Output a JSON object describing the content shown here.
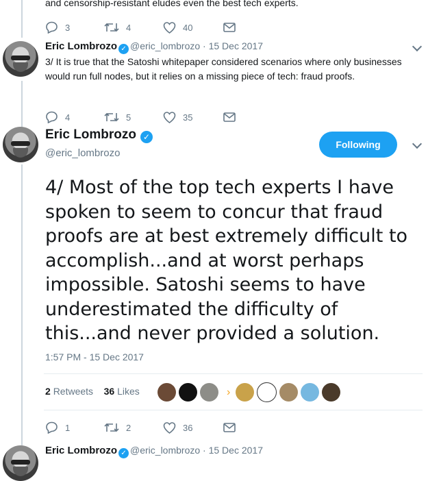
{
  "tweet1": {
    "text_tail": "and censorship-resistant eludes even the best tech experts.",
    "replies": "3",
    "retweets": "4",
    "likes": "40"
  },
  "tweet2": {
    "name": "Eric Lombrozo",
    "handle": "@eric_lombrozo",
    "date": "· 15 Dec 2017",
    "text": "3/ It is true that the Satoshi whitepaper considered scenarios where only businesses would run full nodes, but it relies on a missing piece of tech: fraud proofs.",
    "replies": "4",
    "retweets": "5",
    "likes": "35"
  },
  "main": {
    "name": "Eric Lombrozo",
    "handle": "@eric_lombrozo",
    "follow_label": "Following",
    "text": "4/ Most of the top tech experts I have spoken to seem to concur that fraud proofs are at best extremely difficult to accomplish...and at worst perhaps impossible. Satoshi seems to have underestimated the difficulty of this...and never provided a solution.",
    "timestamp": "1:57 PM - 15 Dec 2017",
    "retweets_count": "2",
    "retweets_label": "Retweets",
    "likes_count": "36",
    "likes_label": "Likes",
    "replies": "1",
    "retweets": "2",
    "likes": "36"
  },
  "tweet4": {
    "name": "Eric Lombrozo",
    "handle": "@eric_lombrozo",
    "date": "· 15 Dec 2017"
  },
  "colors": {
    "accent": "#1da1f2",
    "muted": "#657786",
    "divider": "#e6ecf0"
  },
  "icons": [
    "reply-icon",
    "retweet-icon",
    "like-icon",
    "message-icon",
    "verified-icon",
    "chevron-down-icon"
  ]
}
